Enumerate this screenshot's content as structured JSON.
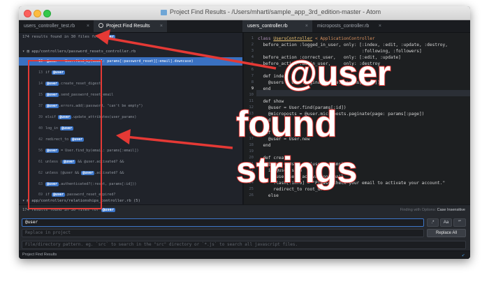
{
  "window": {
    "title": "Project Find Results - /Users/mhartl/sample_app_3rd_edition-master - Atom"
  },
  "left_tabs": [
    {
      "label": "users_controller_test.rb",
      "close": "×"
    },
    {
      "label": "Project Find Results",
      "close": "×"
    }
  ],
  "right_tabs": [
    {
      "label": "users_controller.rb",
      "close": "×"
    },
    {
      "label": "microposts_controller.rb",
      "close": "×"
    }
  ],
  "results": {
    "summary_prefix": "174 results found in 30 files for",
    "query_tag": "@user",
    "files": [
      {
        "path": "app/controllers/password_resets_controller.rb"
      },
      {
        "path": "app/controllers/relationships_controller.rb",
        "count": "(5)"
      }
    ],
    "rows": [
      {
        "line": "10",
        "pre": "",
        "tag": "@user",
        "post": " = User.find_by(email: params[:password_reset][:email].downcase)"
      },
      {
        "line": "13",
        "pre": "if ",
        "tag": "@user",
        "post": ""
      },
      {
        "line": "14",
        "pre": "",
        "tag": "@user",
        "post": ".create_reset_digest"
      },
      {
        "line": "15",
        "pre": "",
        "tag": "@user",
        "post": ".send_password_reset_email"
      },
      {
        "line": "37",
        "pre": "",
        "tag": "@user",
        "post": ".errors.add(:password, \"can't be empty\")"
      },
      {
        "line": "39",
        "pre": "elsif ",
        "tag": "@user",
        "post": ".update_attributes(user_params)"
      },
      {
        "line": "40",
        "pre": "log_in ",
        "tag": "@user",
        "post": ""
      },
      {
        "line": "42",
        "pre": "redirect_to ",
        "tag": "@user",
        "post": ""
      },
      {
        "line": "56",
        "pre": "",
        "tag": "@user",
        "post": " = User.find_by(email: params[:email])"
      },
      {
        "line": "61",
        "pre": "unless (",
        "tag": "@user",
        "post": " && @user.activated? &&"
      },
      {
        "line": "62",
        "pre": "unless (@user && ",
        "tag": "@user",
        "post": ".activated? &&"
      },
      {
        "line": "63",
        "pre": "",
        "tag": "@user",
        "post": ".authenticated?(:reset, params[:id]))"
      },
      {
        "line": "69",
        "pre": "if ",
        "tag": "@user",
        "post": ".password_reset_expired?"
      }
    ],
    "last_row": {
      "line": "5",
      "pre": "",
      "tag": "@user",
      "post": " = User.find(params[:followed_id])"
    }
  },
  "editor": {
    "line_numbers": [
      "1",
      "2",
      "3",
      "4",
      "5",
      "6",
      "7",
      "8",
      "9",
      "10",
      "11",
      "12",
      "13",
      "14",
      "15",
      "16",
      "17",
      "18",
      "19",
      "20",
      "21",
      "22",
      "23",
      "24",
      "25",
      "26"
    ],
    "code": [
      {
        "kw": "class ",
        "name": "UsersController",
        "rest": " < ApplicationController"
      },
      {
        "text": "  before_action :logged_in_user, only: [:index, :edit, :update, :destroy,"
      },
      {
        "text": "                                        :following, :followers]"
      },
      {
        "text": "  before_action :correct_user,   only: [:edit, :update]"
      },
      {
        "text": "  before_action :admin_user,     only: :destroy"
      },
      {
        "text": ""
      },
      {
        "text": "  def index"
      },
      {
        "text": "    @users = User.paginate(page: params[:page])"
      },
      {
        "text": "  end"
      },
      {
        "text": ""
      },
      {
        "text": "  def show"
      },
      {
        "text": "    @user = User.find(params[:id])"
      },
      {
        "text": "    @microposts = @user.microposts.paginate(page: params[:page])"
      },
      {
        "text": "  end"
      },
      {
        "text": ""
      },
      {
        "text": "  def new"
      },
      {
        "text": "    @user = User.new"
      },
      {
        "text": "  end"
      },
      {
        "text": ""
      },
      {
        "text": "  def create"
      },
      {
        "text": "    @user = User.new(user_params)"
      },
      {
        "text": "    if @user.save"
      },
      {
        "text": "      @user.send_activation_email"
      },
      {
        "text": "      flash[:info] = \"Please check your email to activate your account.\""
      },
      {
        "text": "      redirect_to root_url"
      },
      {
        "text": "    else"
      }
    ]
  },
  "find_panel": {
    "status_prefix": "174 results found in 30 files for",
    "status_tag": "@user",
    "finding_with_options": "Finding with Options:",
    "case_insensitive": "Case Insensitive",
    "search_value": "@user",
    "replace_placeholder": "Replace in project",
    "pattern_placeholder": "File/directory pattern. eg. `src` to search in the \"src\" directory or `*.js` to search all javascript files.",
    "regex_label": ".*",
    "case_label": "Aa",
    "word_label": "“”",
    "replace_all_label": "Replace All"
  },
  "footer": {
    "label": "Project Find Results"
  },
  "annotation": {
    "callout_1": "@user",
    "callout_2": "found",
    "callout_3": "strings",
    "color": "#e53935"
  }
}
